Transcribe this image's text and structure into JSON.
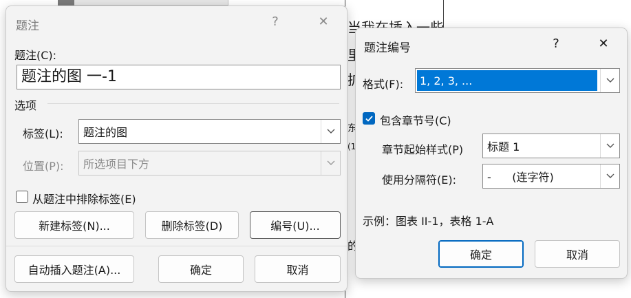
{
  "background": {
    "fragments": [
      "当我在插入一些",
      "里",
      "扩",
      "东",
      "(1",
      "的"
    ]
  },
  "caption_dialog": {
    "title": "题注",
    "help_symbol": "?",
    "close_symbol": "✕",
    "caption_label": "题注(C):",
    "caption_value": "题注的图 一-1",
    "options_title": "选项",
    "label_label": "标签(L):",
    "label_value": "题注的图",
    "position_label": "位置(P):",
    "position_value": "所选项目下方",
    "exclude_label": "从题注中排除标签(E)",
    "new_label_button": "新建标签(N)...",
    "delete_label_button": "删除标签(D)",
    "numbering_button": "编号(U)...",
    "autocaption_button": "自动插入题注(A)...",
    "ok_button": "确定",
    "cancel_button": "取消"
  },
  "numbering_dialog": {
    "title": "题注编号",
    "help_symbol": "?",
    "close_symbol": "✕",
    "format_label": "格式(F):",
    "format_value": "1, 2, 3, ...",
    "include_chapter_label": "包含章节号(C)",
    "include_chapter_checked": true,
    "chapter_style_label": "章节起始样式(P)",
    "chapter_style_value": "标题 1",
    "separator_label": "使用分隔符(E):",
    "separator_value": "-      (连字符)",
    "example_text": "示例：图表 II-1，表格 1-A",
    "ok_button": "确定",
    "cancel_button": "取消"
  },
  "colors": {
    "accent": "#0067c0",
    "selection": "#0078d7",
    "dialog_bg": "#f3f3f3"
  }
}
